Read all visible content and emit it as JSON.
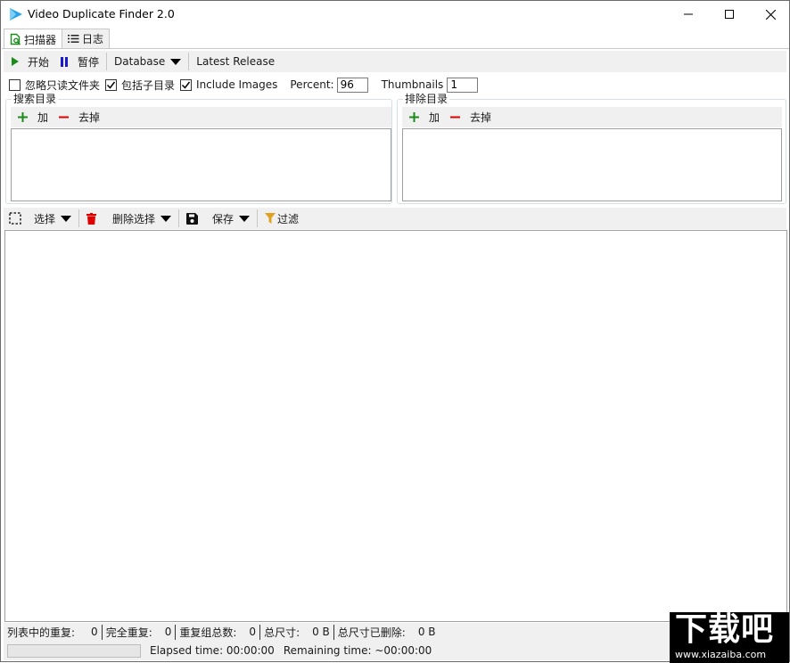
{
  "window": {
    "title": "Video Duplicate Finder 2.0",
    "controls": {
      "minimize": "minimize",
      "maximize": "maximize",
      "close": "close"
    }
  },
  "tabs": [
    {
      "label": "扫描器",
      "icon": "scan-document-icon",
      "active": true
    },
    {
      "label": "日志",
      "icon": "list-icon",
      "active": false
    }
  ],
  "toolbar": {
    "start_label": "开始",
    "pause_label": "暂停",
    "database_label": "Database",
    "latest_release_label": "Latest Release"
  },
  "options": {
    "ignore_readonly": {
      "label": "忽略只读文件夹",
      "checked": false
    },
    "include_subdirs": {
      "label": "包括子目录",
      "checked": true
    },
    "include_images": {
      "label": "Include Images",
      "checked": true
    },
    "percent_label": "Percent:",
    "percent_value": "96",
    "thumbnails_label": "Thumbnails",
    "thumbnails_value": "1"
  },
  "search_dirs": {
    "title": "搜索目录",
    "add_label": "加",
    "remove_label": "去掉",
    "items": []
  },
  "exclude_dirs": {
    "title": "排除目录",
    "add_label": "加",
    "remove_label": "去掉",
    "items": []
  },
  "results_toolbar": {
    "select_label": "选择",
    "delete_selection_label": "删除选择",
    "save_label": "保存",
    "filter_label": "过滤"
  },
  "results": [],
  "status": {
    "dupes_in_list_label": "列表中的重复:",
    "dupes_in_list_value": "0",
    "exact_dupes_label": "完全重复:",
    "exact_dupes_value": "0",
    "total_groups_label": "重复组总数:",
    "total_groups_value": "0",
    "total_size_label": "总尺寸:",
    "total_size_value": "0 B",
    "total_size_removed_label": "总尺寸已删除:",
    "total_size_removed_value": "0 B",
    "progress_percent": 0,
    "elapsed_time": "Elapsed time: 00:00:00",
    "remaining_time": "Remaining time: ~00:00:00"
  },
  "watermark": {
    "text": "下载吧",
    "url": "www.xiazaiba.com"
  },
  "colors": {
    "accent_green": "#1a8a1a",
    "accent_red": "#e00000",
    "pause_blue": "#1a1acc",
    "filter_gold": "#e0a020",
    "app_icon_blue": "#2aa4e8"
  }
}
